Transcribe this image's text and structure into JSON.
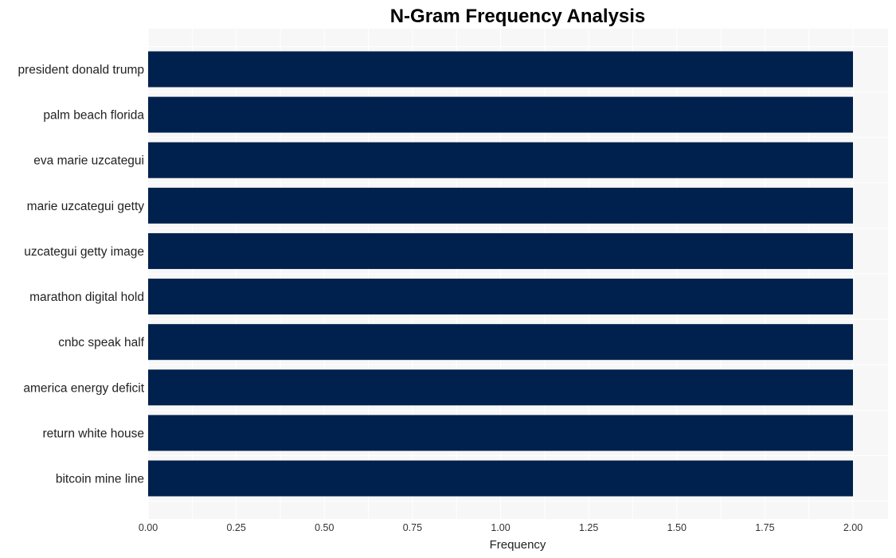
{
  "chart_data": {
    "type": "bar",
    "orientation": "horizontal",
    "title": "N-Gram Frequency Analysis",
    "xlabel": "Frequency",
    "ylabel": "",
    "categories": [
      "president donald trump",
      "palm beach florida",
      "eva marie uzcategui",
      "marie uzcategui getty",
      "uzcategui getty image",
      "marathon digital hold",
      "cnbc speak half",
      "america energy deficit",
      "return white house",
      "bitcoin mine line"
    ],
    "values": [
      2,
      2,
      2,
      2,
      2,
      2,
      2,
      2,
      2,
      2
    ],
    "xlim": [
      0,
      2.1
    ],
    "xticks": [
      0,
      0.25,
      0.5,
      0.75,
      1.0,
      1.25,
      1.5,
      1.75,
      2.0
    ],
    "xtick_labels": [
      "0.00",
      "0.25",
      "0.50",
      "0.75",
      "1.00",
      "1.25",
      "1.50",
      "1.75",
      "2.00"
    ],
    "grid": true,
    "legend": "none",
    "colors": {
      "bar": "#00214d",
      "panel": "#f7f7f7",
      "grid": "#ffffff"
    }
  }
}
